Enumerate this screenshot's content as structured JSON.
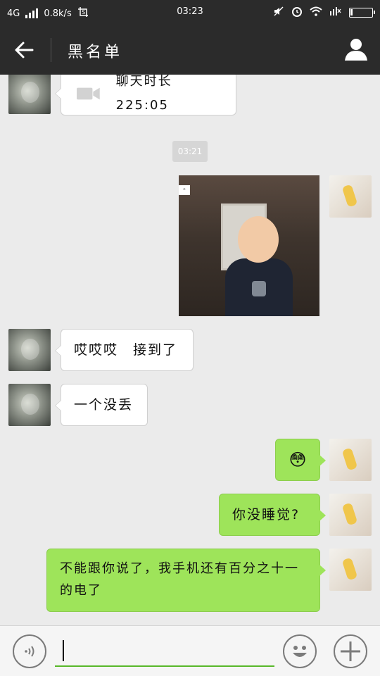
{
  "status": {
    "network": "4G",
    "speed": "0.8k/s",
    "time": "03:23",
    "battery_level": 0.11
  },
  "titlebar": {
    "title": "黑名单"
  },
  "timestamp": "03:21",
  "messages": [
    {
      "sender": "friend",
      "kind": "video-call",
      "text": "聊天时长 225:05"
    },
    {
      "sender": "me",
      "kind": "image"
    },
    {
      "sender": "friend",
      "kind": "text",
      "text": "哎哎哎　接到了"
    },
    {
      "sender": "friend",
      "kind": "text",
      "text": "一个没丢"
    },
    {
      "sender": "me",
      "kind": "emoji",
      "emoji": "😳"
    },
    {
      "sender": "me",
      "kind": "text",
      "text": "你没睡觉?"
    },
    {
      "sender": "me",
      "kind": "text",
      "text": "不能跟你说了，我手机还有百分之十一的电了"
    }
  ],
  "colors": {
    "topbar": "#2b2b2b",
    "background": "#ebebeb",
    "green_bubble": "#9ee45a",
    "input_accent": "#57b829"
  },
  "icons": {
    "back": "arrow-left-icon",
    "profile": "person-icon",
    "video": "video-camera-icon",
    "voice": "voice-icon",
    "emoji": "smiley-face-icon",
    "plus": "plus-icon"
  }
}
